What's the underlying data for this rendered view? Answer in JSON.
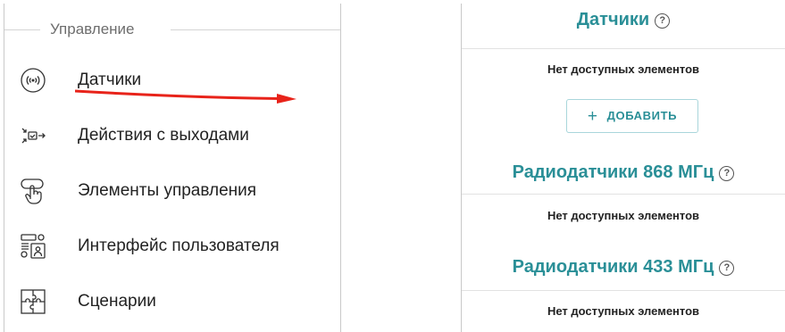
{
  "left": {
    "section_title": "Управление",
    "items": [
      {
        "label": "Датчики",
        "icon": "sensor-icon"
      },
      {
        "label": "Действия с выходами",
        "icon": "output-actions-icon"
      },
      {
        "label": "Элементы управления",
        "icon": "touch-control-icon"
      },
      {
        "label": "Интерфейс пользователя",
        "icon": "user-interface-icon"
      },
      {
        "label": "Сценарии",
        "icon": "puzzle-icon"
      }
    ],
    "annotation_color": "#e8231a"
  },
  "right": {
    "groups": [
      {
        "title": "Датчики",
        "empty_text": "Нет доступных элементов",
        "add_label": "ДОБАВИТЬ"
      },
      {
        "title": "Радиодатчики 868 МГц",
        "empty_text": "Нет доступных элементов"
      },
      {
        "title": "Радиодатчики 433 МГц",
        "empty_text": "Нет доступных элементов"
      }
    ],
    "help_glyph": "?",
    "add_glyph": "+",
    "accent_color": "#2a8f97"
  }
}
